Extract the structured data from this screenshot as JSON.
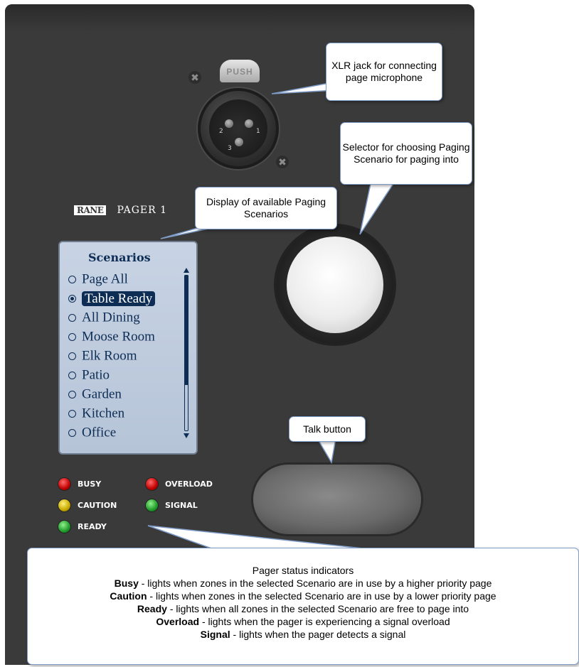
{
  "device": {
    "push_label": "PUSH",
    "brand_logo": "RANE",
    "model": "PAGER 1",
    "pins": [
      "1",
      "2",
      "3"
    ]
  },
  "display": {
    "title": "Scenarios",
    "scenarios": [
      {
        "label": "Page All",
        "selected": false
      },
      {
        "label": "Table Ready",
        "selected": true
      },
      {
        "label": "All Dining",
        "selected": false
      },
      {
        "label": "Moose Room",
        "selected": false
      },
      {
        "label": "Elk Room",
        "selected": false
      },
      {
        "label": "Patio",
        "selected": false
      },
      {
        "label": "Garden",
        "selected": false
      },
      {
        "label": "Kitchen",
        "selected": false
      },
      {
        "label": "Office",
        "selected": false
      }
    ]
  },
  "leds": [
    {
      "label": "BUSY",
      "color": "red"
    },
    {
      "label": "OVERLOAD",
      "color": "red"
    },
    {
      "label": "CAUTION",
      "color": "yellow"
    },
    {
      "label": "SIGNAL",
      "color": "green"
    },
    {
      "label": "READY",
      "color": "green"
    }
  ],
  "callouts": {
    "xlr": "XLR jack for connecting page microphone",
    "selector": "Selector for choosing Paging Scenario for paging into",
    "display": "Display of available Paging Scenarios",
    "talk": "Talk button"
  },
  "status": {
    "title": "Pager status indicators",
    "lines": [
      {
        "term": "Busy",
        "text": " - lights when zones in the selected Scenario are in use by a higher priority page"
      },
      {
        "term": "Caution",
        "text": " - lights when zones in the selected Scenario are in use by a lower priority page"
      },
      {
        "term": "Ready",
        "text": " - lights when all zones in the selected Scenario are free to page into"
      },
      {
        "term": "Overload",
        "text": " - lights when the pager is experiencing a signal overload"
      },
      {
        "term": "Signal",
        "text": " - lights when the pager detects a signal"
      }
    ]
  },
  "colors": {
    "panel": "#3a3a3a",
    "lcd": "#c8d4e4",
    "lcd_text": "#0d2d55",
    "callout_border": "#7f9cc8"
  }
}
